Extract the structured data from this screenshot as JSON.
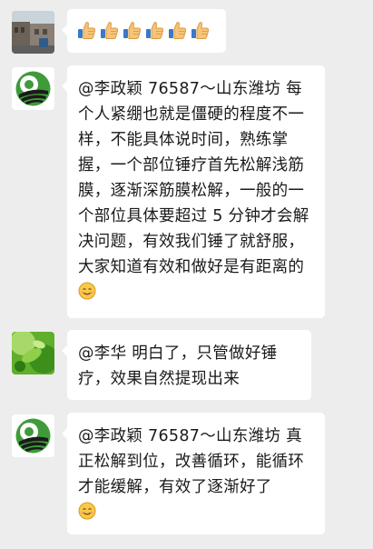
{
  "messages": [
    {
      "avatar": "street-photo-avatar",
      "emoji": [
        "thumbs-up-icon",
        "thumbs-up-icon",
        "thumbs-up-icon",
        "thumbs-up-icon",
        "thumbs-up-icon",
        "thumbs-up-icon"
      ]
    },
    {
      "avatar": "green-logo-avatar",
      "text": "@李政颖 76587～山东潍坊  每个人紧绷也就是僵硬的程度不一样，不能具体说时间，熟练掌握，一个部位锤疗首先松解浅筋膜，逐渐深筋膜松解，一般的一个部位具体要超过 5 分钟才会解决问题，有效我们锤了就舒服，大家知道有效和做好是有距离的",
      "trailing_emoji": "smile-icon"
    },
    {
      "avatar": "leaf-photo-avatar",
      "text": "@李华  明白了，只管做好锤疗，效果自然提现出来"
    },
    {
      "avatar": "green-logo-avatar",
      "text": "@李政颖 76587～山东潍坊  真正松解到位，改善循环，能循环才能缓解，有效了逐渐好了",
      "trailing_emoji": "smile-icon"
    }
  ],
  "colors": {
    "background": "#ededed",
    "bubble": "#ffffff",
    "text": "#1a1a1a",
    "logo_green": "#3f9b3a"
  }
}
